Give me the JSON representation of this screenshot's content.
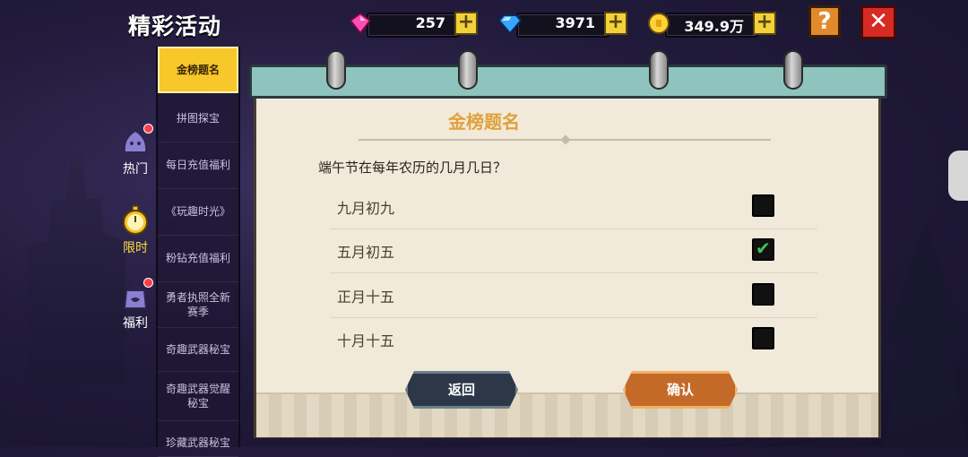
{
  "header": {
    "title": "精彩活动"
  },
  "currencies": [
    {
      "icon": "pink-gem-icon",
      "value": "257",
      "color": "#ff4fb4"
    },
    {
      "icon": "blue-diamond-icon",
      "value": "3971",
      "color": "#37a6ff"
    },
    {
      "icon": "gold-coin-icon",
      "value": "349.9万",
      "color": "#ffd23a"
    }
  ],
  "buttons": {
    "help": "?",
    "close": "✕"
  },
  "categories": [
    {
      "label": "热门",
      "icon": "slime-icon"
    },
    {
      "label": "限时",
      "icon": "stopwatch-icon"
    },
    {
      "label": "福利",
      "icon": "gift-bag-icon"
    }
  ],
  "menu": [
    {
      "label": "金榜题名",
      "active": true
    },
    {
      "label": "拼图探宝"
    },
    {
      "label": "每日充值福利"
    },
    {
      "label": "《玩趣时光》"
    },
    {
      "label": "粉钻充值福利"
    },
    {
      "label": "勇者执照全新赛季"
    },
    {
      "label": "奇趣武器秘宝"
    },
    {
      "label": "奇趣武器觉醒秘宝"
    },
    {
      "label": "珍藏武器秘宝"
    }
  ],
  "quiz": {
    "title": "金榜题名",
    "question": "端午节在每年农历的几月几日？",
    "options": [
      {
        "label": "九月初九",
        "checked": false
      },
      {
        "label": "五月初五",
        "checked": true
      },
      {
        "label": "正月十五",
        "checked": false
      },
      {
        "label": "十月十五",
        "checked": false
      }
    ],
    "back_label": "返回",
    "confirm_label": "确认"
  }
}
